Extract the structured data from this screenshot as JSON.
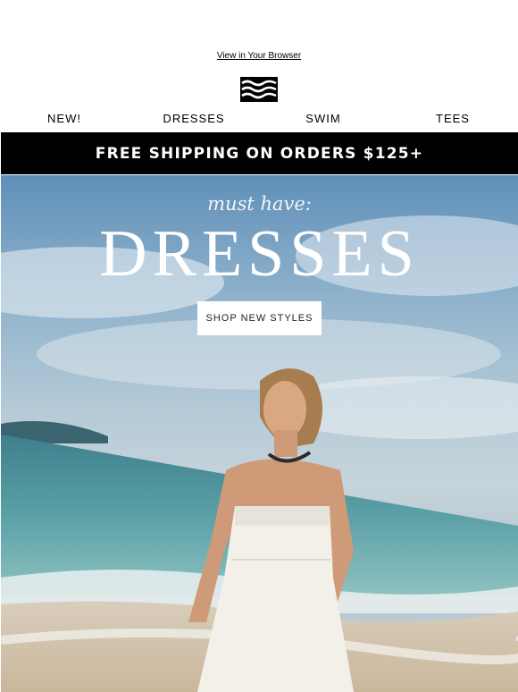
{
  "header": {
    "view_in_browser": "View in Your Browser",
    "logo_icon": "billabong-wave-logo"
  },
  "nav": {
    "items": [
      {
        "label": "NEW!"
      },
      {
        "label": "DRESSES"
      },
      {
        "label": "SWIM"
      },
      {
        "label": "TEES"
      }
    ]
  },
  "banner": {
    "text": "FREE SHIPPING ON ORDERS $125+"
  },
  "hero": {
    "kicker": "must have:",
    "title": "DRESSES",
    "cta_label": "SHOP NEW STYLES"
  },
  "colors": {
    "banner_bg": "#000000",
    "banner_text": "#ffffff",
    "cta_bg": "#ffffff"
  }
}
